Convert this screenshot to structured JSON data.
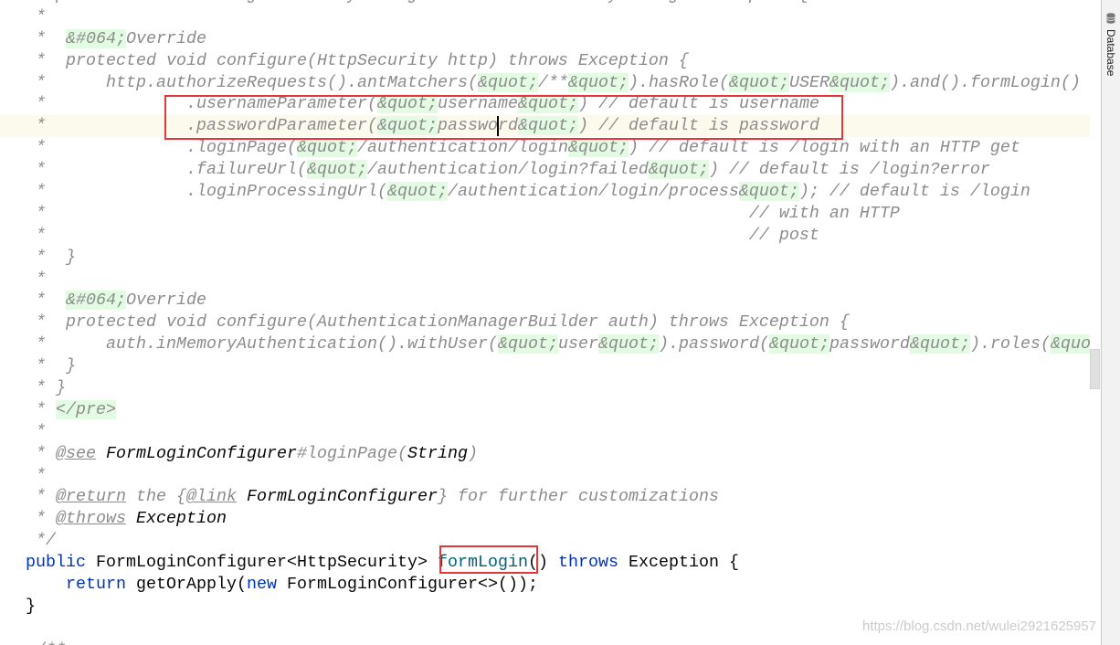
{
  "side_panel": {
    "label": "Database",
    "icon": "database-icon"
  },
  "watermark": "https://blog.csdn.net/wulei2921625957",
  "colors": {
    "highlight_box": "#e8353a",
    "quote_entity_bg": "#e3fbe3",
    "current_line": "#fcfaed",
    "keyword": "#0033b3",
    "comment": "#8c8c8c"
  },
  "code_lines": [
    [
      [
        "c",
        "   public class FormLoginSecurityConfig extends WebSecurityConfigurerAdapter {"
      ]
    ],
    [
      [
        "c",
        " *"
      ]
    ],
    [
      [
        "c",
        " *  "
      ],
      [
        "g",
        "&#064;"
      ],
      [
        "c",
        "Override"
      ]
    ],
    [
      [
        "c",
        " *  protected void configure(HttpSecurity http) throws Exception {"
      ]
    ],
    [
      [
        "c",
        " *      http.authorizeRequests().antMatchers("
      ],
      [
        "g",
        "&quot;"
      ],
      [
        "c",
        "/**"
      ],
      [
        "g",
        "&quot;"
      ],
      [
        "c",
        ").hasRole("
      ],
      [
        "g",
        "&quot;"
      ],
      [
        "c",
        "USER"
      ],
      [
        "g",
        "&quot;"
      ],
      [
        "c",
        ").and().formLogin()"
      ]
    ],
    [
      [
        "c",
        " *              .usernameParameter("
      ],
      [
        "g",
        "&quot;"
      ],
      [
        "c",
        "username"
      ],
      [
        "g",
        "&quot;"
      ],
      [
        "c",
        ") // default is username"
      ]
    ],
    [
      [
        "c",
        " *              .passwordParameter("
      ],
      [
        "g",
        "&quot;"
      ],
      [
        "c",
        "password"
      ],
      [
        "g",
        "&quot;"
      ],
      [
        "c",
        ") // default is password"
      ]
    ],
    [
      [
        "c",
        " *              .loginPage("
      ],
      [
        "g",
        "&quot;"
      ],
      [
        "c",
        "/authentication/login"
      ],
      [
        "g",
        "&quot;"
      ],
      [
        "c",
        ") // default is /login with an HTTP get"
      ]
    ],
    [
      [
        "c",
        " *              .failureUrl("
      ],
      [
        "g",
        "&quot;"
      ],
      [
        "c",
        "/authentication/login?failed"
      ],
      [
        "g",
        "&quot;"
      ],
      [
        "c",
        ") // default is /login?error"
      ]
    ],
    [
      [
        "c",
        " *              .loginProcessingUrl("
      ],
      [
        "g",
        "&quot;"
      ],
      [
        "c",
        "/authentication/login/process"
      ],
      [
        "g",
        "&quot;"
      ],
      [
        "c",
        "); // default is /login"
      ]
    ],
    [
      [
        "c",
        " *                                                                      // with an HTTP"
      ]
    ],
    [
      [
        "c",
        " *                                                                      // post"
      ]
    ],
    [
      [
        "c",
        " *  }"
      ]
    ],
    [
      [
        "c",
        " *"
      ]
    ],
    [
      [
        "c",
        " *  "
      ],
      [
        "g",
        "&#064;"
      ],
      [
        "c",
        "Override"
      ]
    ],
    [
      [
        "c",
        " *  protected void configure(AuthenticationManagerBuilder auth) throws Exception {"
      ]
    ],
    [
      [
        "c",
        " *      auth.inMemoryAuthentication().withUser("
      ],
      [
        "g",
        "&quot;"
      ],
      [
        "c",
        "user"
      ],
      [
        "g",
        "&quot;"
      ],
      [
        "c",
        ").password("
      ],
      [
        "g",
        "&quot;"
      ],
      [
        "c",
        "password"
      ],
      [
        "g",
        "&quot;"
      ],
      [
        "c",
        ").roles("
      ],
      [
        "g",
        "&quot"
      ]
    ],
    [
      [
        "c",
        " *  }"
      ]
    ],
    [
      [
        "c",
        " * }"
      ]
    ],
    [
      [
        "c",
        " * "
      ],
      [
        "g",
        "</pre>"
      ]
    ],
    [
      [
        "c",
        " *"
      ]
    ],
    [
      [
        "c",
        " * "
      ],
      [
        "tag",
        "@see"
      ],
      [
        "c",
        " "
      ],
      [
        "dr",
        "FormLoginConfigurer"
      ],
      [
        "c",
        "#loginPage("
      ],
      [
        "dr",
        "String"
      ],
      [
        "c",
        ")"
      ]
    ],
    [
      [
        "c",
        " *"
      ]
    ],
    [
      [
        "c",
        " * "
      ],
      [
        "tag",
        "@return"
      ],
      [
        "c",
        " the {"
      ],
      [
        "tag",
        "@link"
      ],
      [
        "c",
        " "
      ],
      [
        "dr",
        "FormLoginConfigurer"
      ],
      [
        "c",
        "} for further customizations"
      ]
    ],
    [
      [
        "c",
        " * "
      ],
      [
        "tag",
        "@throws"
      ],
      [
        "c",
        " "
      ],
      [
        "dr",
        "Exception"
      ]
    ],
    [
      [
        "c",
        " */"
      ]
    ],
    [
      [
        "k",
        "public "
      ],
      [
        "t",
        "FormLoginConfigurer<HttpSecurity> "
      ],
      [
        "m",
        "formLogin"
      ],
      [
        "t",
        "() "
      ],
      [
        "k",
        "throws "
      ],
      [
        "t",
        "Exception {"
      ]
    ],
    [
      [
        "t",
        "    "
      ],
      [
        "k",
        "return "
      ],
      [
        "t",
        "getOrApply("
      ],
      [
        "k",
        "new "
      ],
      [
        "t",
        "FormLoginConfigurer<>());"
      ]
    ],
    [
      [
        "t",
        "}"
      ]
    ],
    [
      [
        "t",
        ""
      ]
    ],
    [
      [
        "c",
        " /**"
      ]
    ]
  ]
}
